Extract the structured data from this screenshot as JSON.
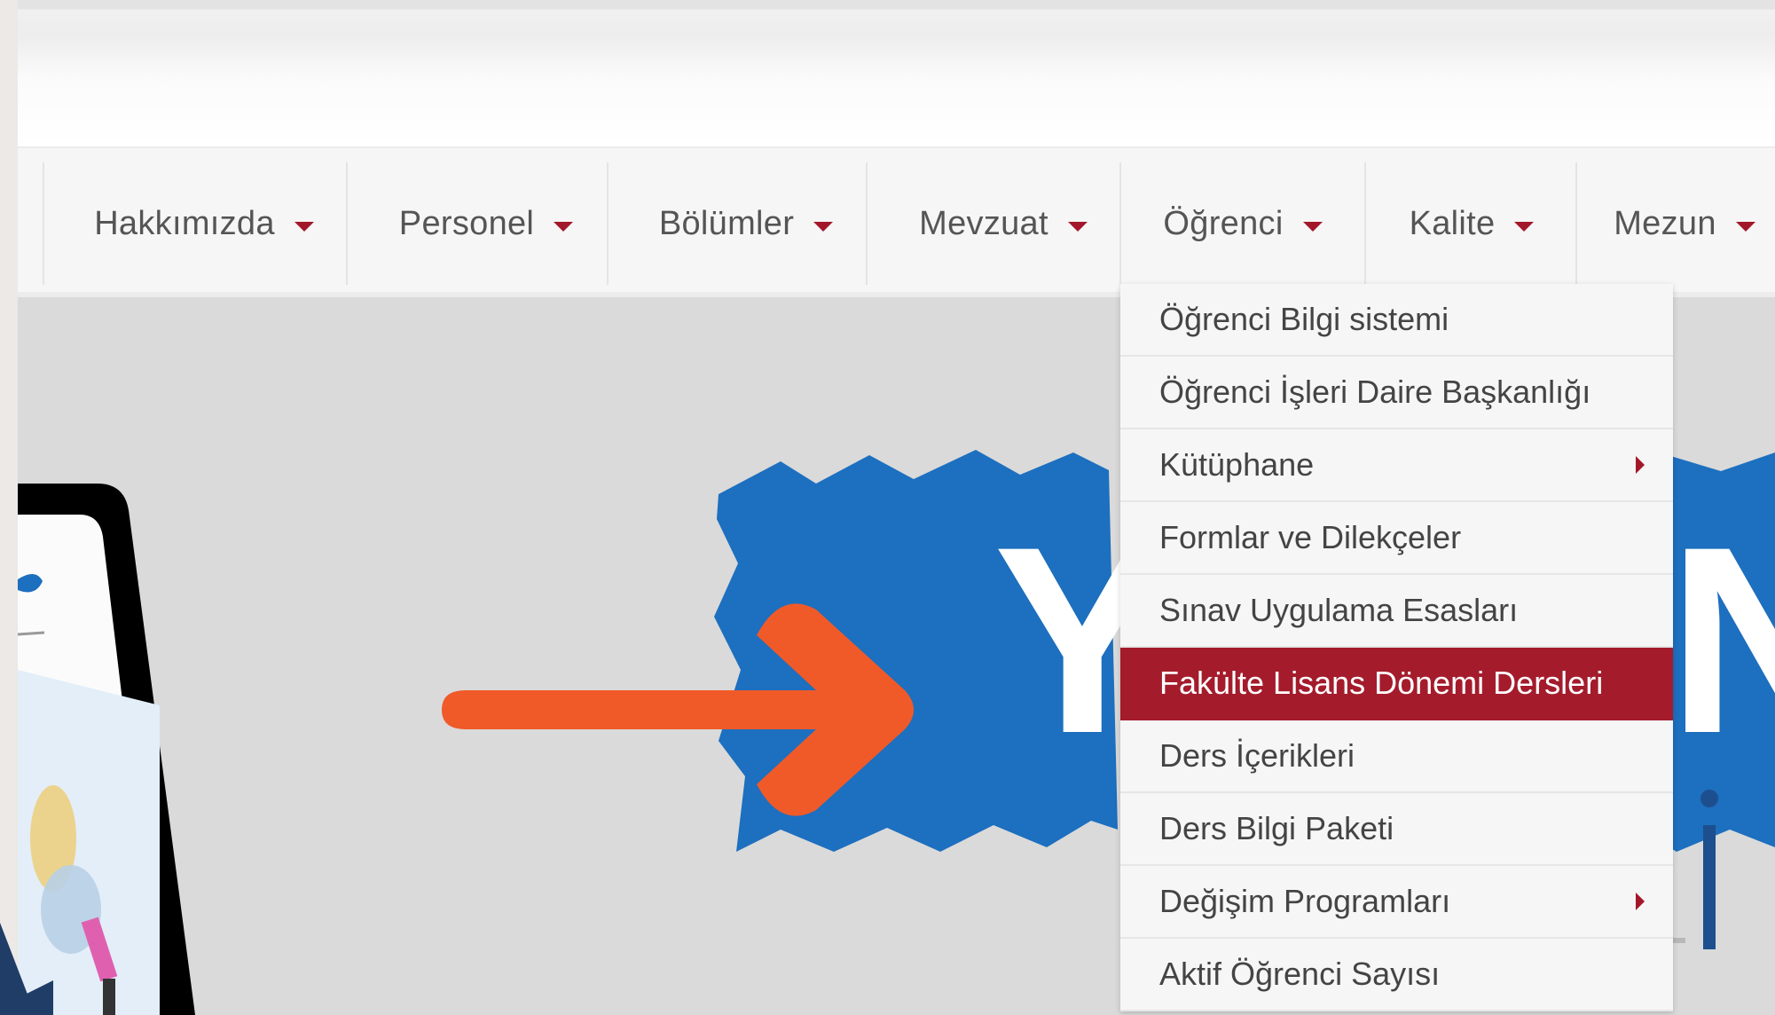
{
  "nav": {
    "items": [
      {
        "label": "Hakkımızda"
      },
      {
        "label": "Personel"
      },
      {
        "label": "Bölümler"
      },
      {
        "label": "Mevzuat"
      },
      {
        "label": "Öğrenci"
      },
      {
        "label": "Kalite"
      },
      {
        "label": "Mezun"
      }
    ],
    "caret_color": "#a3172a"
  },
  "dropdown": {
    "items": [
      {
        "label": "Öğrenci Bilgi sistemi"
      },
      {
        "label": "Öğrenci İşleri Daire Başkanlığı"
      },
      {
        "label": "Kütüphane",
        "has_submenu": true
      },
      {
        "label": "Formlar ve Dilekçeler"
      },
      {
        "label": "Sınav Uygulama Esasları"
      },
      {
        "label": "Fakülte Lisans Dönemi Dersleri",
        "highlighted": true
      },
      {
        "label": "Ders İçerikleri"
      },
      {
        "label": "Ders Bilgi Paketi"
      },
      {
        "label": "Değişim Programları",
        "has_submenu": true
      },
      {
        "label": "Aktif Öğrenci Sayısı"
      }
    ],
    "highlight_color": "#a41c2c"
  },
  "hero": {
    "banner_color": "#1d6fbf",
    "arrow_color": "#f05a28"
  }
}
